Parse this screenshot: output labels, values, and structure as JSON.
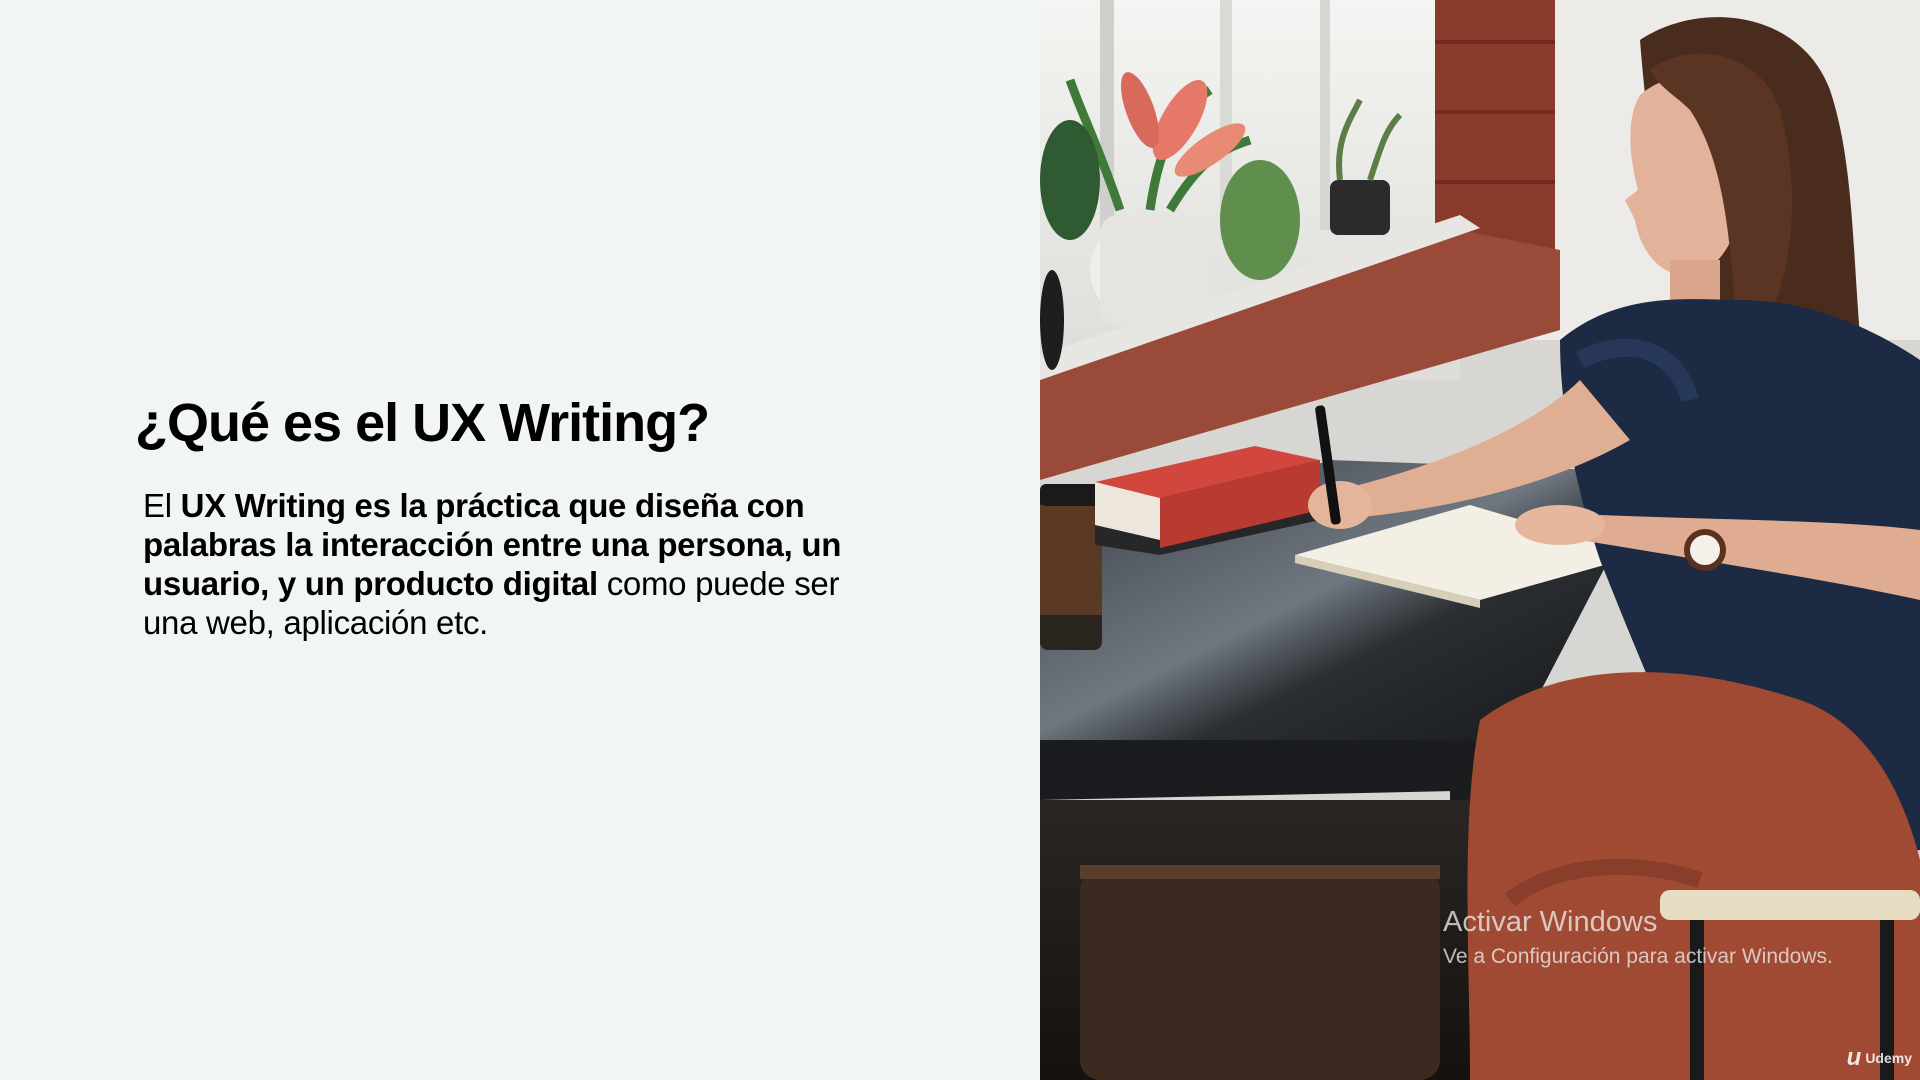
{
  "slide": {
    "title": "¿Qué es el UX Writing?",
    "body": {
      "intro": "El ",
      "bold": "UX Writing es la práctica que diseña con palabras la interacción entre una persona, un usuario, y un producto digital",
      "rest": " como puede ser una web, aplicación etc."
    }
  },
  "overlay": {
    "watermark_title": "Activar Windows",
    "watermark_subtitle": "Ve a Configuración para activar Windows.",
    "brand_icon": "u",
    "brand_name": "Udemy"
  },
  "colors": {
    "background": "#f2f5f6",
    "text": "#000000",
    "brick": "#8a3a2a",
    "shirt": "#1c2a44",
    "pants": "#a14a33",
    "book": "#d2473d"
  },
  "icons": {
    "brand": "udemy-logo-icon"
  }
}
